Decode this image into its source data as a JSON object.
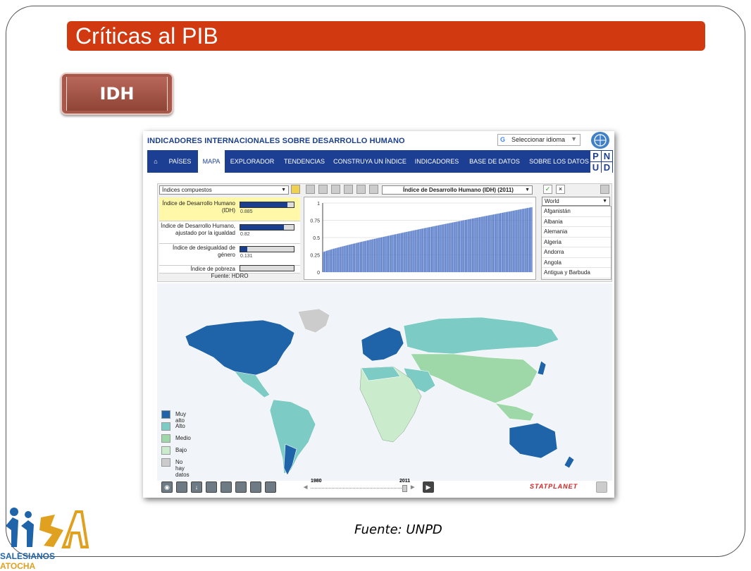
{
  "slide": {
    "title": "Críticas al PIB",
    "subtitle_box": "IDH",
    "caption": "Fuente: UNPD",
    "logo": {
      "text_part1": "SALESIANOS",
      "text_part2": "ATOCHA"
    }
  },
  "app": {
    "header_title": "INDICADORES INTERNACIONALES SOBRE DESARROLLO HUMANO",
    "language_select": "Seleccionar idioma",
    "nav": [
      {
        "label": "PAÍSES"
      },
      {
        "label": "MAPA"
      },
      {
        "label": "EXPLORADOR"
      },
      {
        "label": "TENDENCIAS"
      },
      {
        "label": "CONSTRUYA UN ÍNDICE"
      },
      {
        "label": "INDICADORES"
      },
      {
        "label": "BASE DE DATOS"
      },
      {
        "label": "SOBRE LOS DATOS"
      }
    ],
    "pnud": [
      "P",
      "N",
      "U",
      "D"
    ],
    "category_select": "Índices compuestos",
    "indicator_select": "Índice de Desarrollo Humano (IDH) (2011)",
    "region_select": "World",
    "indices": [
      {
        "label1": "Índice de Desarrollo Humano",
        "label2": "(IDH)",
        "value": 0.885,
        "value_text": "0.885"
      },
      {
        "label1": "Índice de Desarrollo Humano,",
        "label2": "ajustado por la igualdad",
        "value": 0.82,
        "value_text": "0.82"
      },
      {
        "label1": "Índice de desigualdad de",
        "label2": "género",
        "value": 0.131,
        "value_text": "0.131"
      },
      {
        "label1": "",
        "label2": "Índice de pobreza",
        "value": 0,
        "value_text": ""
      }
    ],
    "source": "Fuente: HDRO",
    "countries": [
      "Afganistán",
      "Albania",
      "Alemania",
      "Algeria",
      "Andorra",
      "Angola",
      "Antigua y Barbuda"
    ],
    "legend": [
      {
        "label": "Muy alto",
        "color": "#1f63a8"
      },
      {
        "label": "Alto",
        "color": "#7ccbc5"
      },
      {
        "label": "Medio",
        "color": "#9ed8a8"
      },
      {
        "label": "Bajo",
        "color": "#cbeccc"
      },
      {
        "label": "No hay datos",
        "color": "#cccccc"
      }
    ],
    "timeline": {
      "start": "1980",
      "end": "2011"
    },
    "brand": "STATPLANET"
  },
  "chart_data": {
    "type": "bar",
    "yticks": [
      "1",
      "0.75",
      "0.5",
      "0.25",
      "0"
    ],
    "ylim": [
      0,
      1
    ],
    "bar_count": 180,
    "min_value": 0.29,
    "max_value": 0.94,
    "bar_color": "#5a7dc9"
  }
}
